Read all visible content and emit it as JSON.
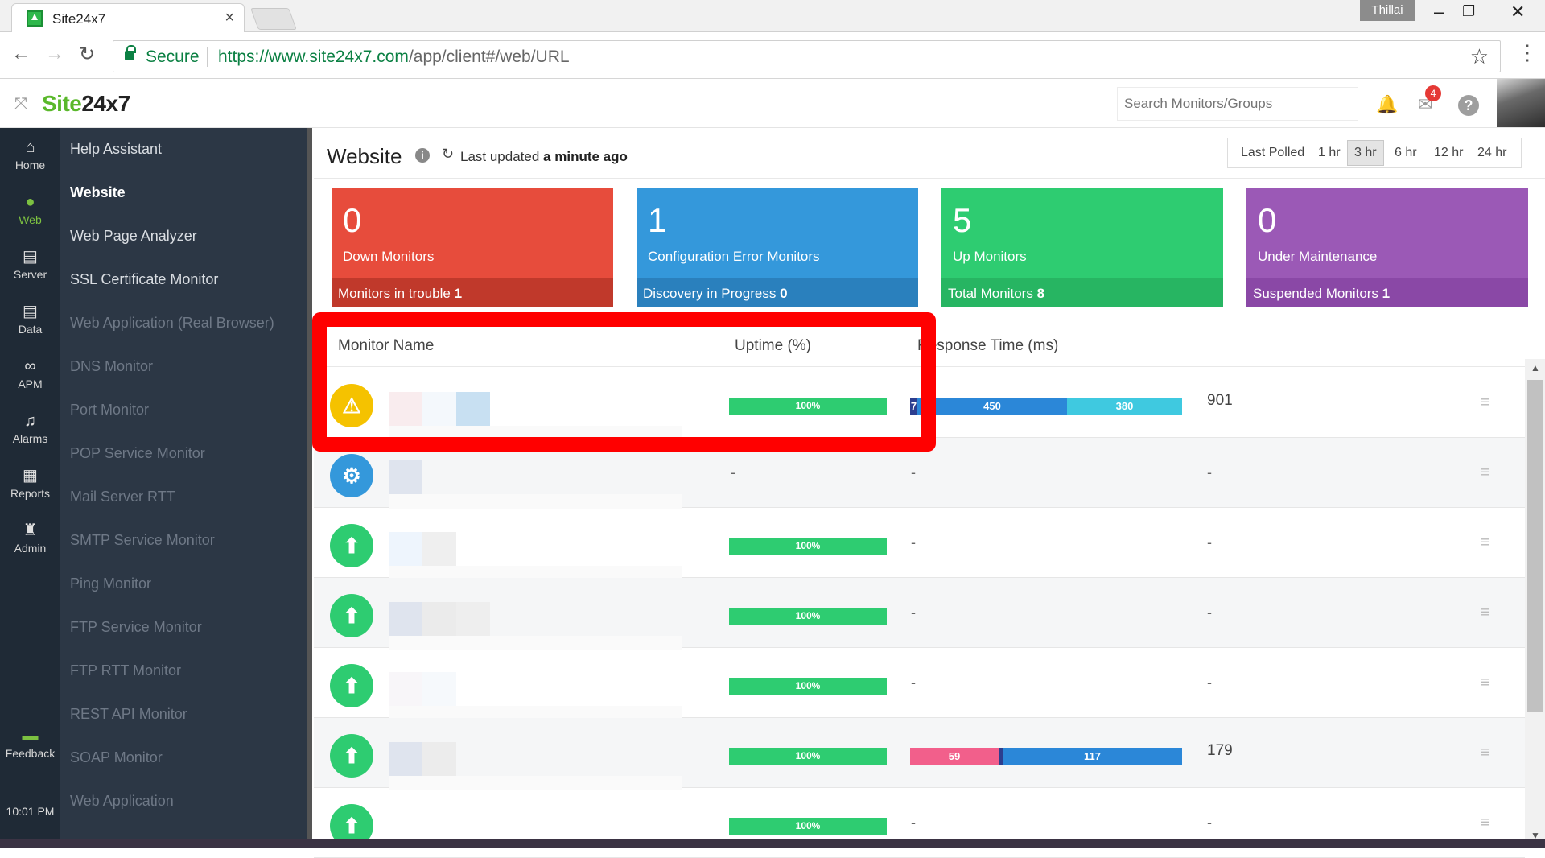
{
  "browser": {
    "tab_title": "Site24x7",
    "close_tab": "×",
    "user_badge": "Thillai",
    "secure_label": "Secure",
    "url_prefix": "https://www.site24x7.com",
    "url_path": "/app/client#/web/URL"
  },
  "header": {
    "logo_site": "Site",
    "logo_suffix": "24x7",
    "search_placeholder": "Search Monitors/Groups",
    "notification_count": "4",
    "help_label": "?"
  },
  "icon_nav": [
    {
      "label": "Home",
      "icon": "home-icon"
    },
    {
      "label": "Web",
      "icon": "globe-icon"
    },
    {
      "label": "Server",
      "icon": "server-icon"
    },
    {
      "label": "Data",
      "icon": "database-icon"
    },
    {
      "label": "APM",
      "icon": "binoculars-icon"
    },
    {
      "label": "Alarms",
      "icon": "bell-icon"
    },
    {
      "label": "Reports",
      "icon": "chart-icon"
    },
    {
      "label": "Admin",
      "icon": "admin-icon"
    },
    {
      "label": "Feedback",
      "icon": "feedback-icon"
    }
  ],
  "clock": "10:01 PM",
  "submenu": [
    "Help Assistant",
    "Website",
    "Web Page Analyzer",
    "SSL Certificate Monitor",
    "Web Application (Real Browser)",
    "DNS Monitor",
    "Port Monitor",
    "POP Service Monitor",
    "Mail Server RTT",
    "SMTP Service Monitor",
    "Ping Monitor",
    "FTP Service Monitor",
    "FTP RTT Monitor",
    "REST API Monitor",
    "SOAP Monitor",
    "Web Application"
  ],
  "page": {
    "title": "Website",
    "last_updated_prefix": "Last updated",
    "last_updated_value": "a minute ago",
    "time_filters": [
      "Last Polled",
      "1 hr",
      "3 hr",
      "6 hr",
      "12 hr",
      "24 hr"
    ],
    "selected_filter": "3 hr"
  },
  "cards": [
    {
      "num": "0",
      "label": "Down Monitors",
      "foot_label": "Monitors in trouble",
      "foot_value": "1",
      "color": "#e74c3c",
      "foot_color": "#c0392b"
    },
    {
      "num": "1",
      "label": "Configuration Error Monitors",
      "foot_label": "Discovery in Progress",
      "foot_value": "0",
      "color": "#3498db",
      "foot_color": "#2a80bd"
    },
    {
      "num": "5",
      "label": "Up Monitors",
      "foot_label": "Total Monitors",
      "foot_value": "8",
      "color": "#2ecc71",
      "foot_color": "#27b562"
    },
    {
      "num": "0",
      "label": "Under Maintenance",
      "foot_label": "Suspended Monitors",
      "foot_value": "1",
      "color": "#9b59b6",
      "foot_color": "#8a48a6"
    }
  ],
  "table": {
    "headers": [
      "Monitor Name",
      "Uptime (%)",
      "Response Time (ms)"
    ],
    "rows": [
      {
        "status": "warning",
        "uptime": "100%",
        "rt_segments": [
          "7",
          "450",
          "380"
        ],
        "rt_total": "901",
        "dash_uptime": "",
        "dash_rt": "",
        "dash_total": ""
      },
      {
        "status": "config",
        "uptime": "",
        "rt_segments": [],
        "rt_total": "",
        "dash_uptime": "-",
        "dash_rt": "-",
        "dash_total": "-"
      },
      {
        "status": "up",
        "uptime": "100%",
        "rt_segments": [],
        "rt_total": "",
        "dash_uptime": "",
        "dash_rt": "-",
        "dash_total": "-"
      },
      {
        "status": "up",
        "uptime": "100%",
        "rt_segments": [],
        "rt_total": "",
        "dash_uptime": "",
        "dash_rt": "-",
        "dash_total": "-"
      },
      {
        "status": "up",
        "uptime": "100%",
        "rt_segments": [],
        "rt_total": "",
        "dash_uptime": "",
        "dash_rt": "-",
        "dash_total": "-"
      },
      {
        "status": "up",
        "uptime": "100%",
        "rt_segments": [
          "59",
          "117"
        ],
        "rt_total": "179",
        "dash_uptime": "",
        "dash_rt": "",
        "dash_total": ""
      },
      {
        "status": "up",
        "uptime": "100%",
        "rt_segments": [],
        "rt_total": "",
        "dash_uptime": "",
        "dash_rt": "-",
        "dash_total": "-"
      }
    ]
  },
  "colors": {
    "highlight_box": "#ff0000",
    "sidebar_dark": "#1f2a36",
    "sidebar_sub": "#2c3745",
    "accent_green": "#7cc141",
    "rt_dns": "#2c3e8f",
    "rt_connect": "#2b87d8",
    "rt_firstbyte": "#3fc9e0",
    "rt_pink": "#f25f8b"
  }
}
